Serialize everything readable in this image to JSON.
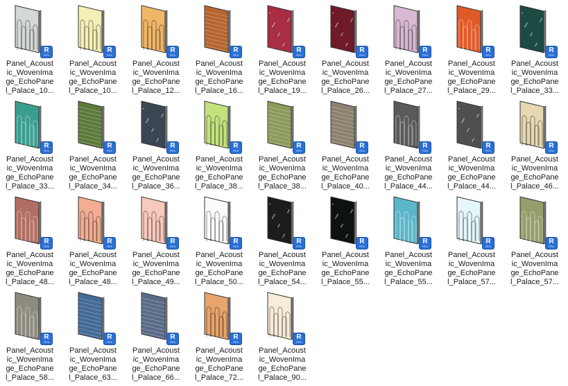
{
  "window": {
    "background": "#ffffff"
  },
  "badge": {
    "letter": "R",
    "sub": "RFA",
    "color": "#2a6fd6"
  },
  "files": [
    {
      "lines": [
        "Panel_Acoust",
        "ic_WovenIma",
        "ge_EchoPane",
        "l_Palace_10..."
      ],
      "color": "#d4d8d6",
      "pattern": "arch",
      "dark": false
    },
    {
      "lines": [
        "Panel_Acoust",
        "ic_WovenIma",
        "ge_EchoPane",
        "l_Palace_10..."
      ],
      "color": "#f3efb6",
      "pattern": "arch",
      "dark": false
    },
    {
      "lines": [
        "Panel_Acoust",
        "ic_WovenIma",
        "ge_EchoPane",
        "l_Palace_12..."
      ],
      "color": "#f0b668",
      "pattern": "arch",
      "dark": false
    },
    {
      "lines": [
        "Panel_Acoust",
        "ic_WovenIma",
        "ge_EchoPane",
        "l_Palace_16..."
      ],
      "color": "#b56530",
      "pattern": "lines",
      "dark": true
    },
    {
      "lines": [
        "Panel_Acoust",
        "ic_WovenIma",
        "ge_EchoPane",
        "l_Palace_19..."
      ],
      "color": "#a82d45",
      "pattern": "dots",
      "dark": true
    },
    {
      "lines": [
        "Panel_Acoust",
        "ic_WovenIma",
        "ge_EchoPane",
        "l_Palace_26..."
      ],
      "color": "#6e1a29",
      "pattern": "dots",
      "dark": true
    },
    {
      "lines": [
        "Panel_Acoust",
        "ic_WovenIma",
        "ge_EchoPane",
        "l_Palace_27..."
      ],
      "color": "#d9b8d3",
      "pattern": "arch",
      "dark": false
    },
    {
      "lines": [
        "Panel_Acoust",
        "ic_WovenIma",
        "ge_EchoPane",
        "l_Palace_29..."
      ],
      "color": "#e05a28",
      "pattern": "arch",
      "dark": true
    },
    {
      "lines": [
        "Panel_Acoust",
        "ic_WovenIma",
        "ge_EchoPane",
        "l_Palace_33..."
      ],
      "color": "#1e4a44",
      "pattern": "dots",
      "dark": true
    },
    {
      "lines": [
        "Panel_Acoust",
        "ic_WovenIma",
        "ge_EchoPane",
        "l_Palace_33..."
      ],
      "color": "#3a9e8e",
      "pattern": "arch",
      "dark": true
    },
    {
      "lines": [
        "Panel_Acoust",
        "ic_WovenIma",
        "ge_EchoPane",
        "l_Palace_34..."
      ],
      "color": "#5d7a3c",
      "pattern": "lines",
      "dark": true
    },
    {
      "lines": [
        "Panel_Acoust",
        "ic_WovenIma",
        "ge_EchoPane",
        "l_Palace_36..."
      ],
      "color": "#3c4552",
      "pattern": "dots",
      "dark": true
    },
    {
      "lines": [
        "Panel_Acoust",
        "ic_WovenIma",
        "ge_EchoPane",
        "l_Palace_38..."
      ],
      "color": "#c3e27e",
      "pattern": "arch",
      "dark": false
    },
    {
      "lines": [
        "Panel_Acoust",
        "ic_WovenIma",
        "ge_EchoPane",
        "l_Palace_38..."
      ],
      "color": "#8c9a5a",
      "pattern": "lines",
      "dark": true
    },
    {
      "lines": [
        "Panel_Acoust",
        "ic_WovenIma",
        "ge_EchoPane",
        "l_Palace_40..."
      ],
      "color": "#8c806e",
      "pattern": "lines",
      "dark": true
    },
    {
      "lines": [
        "Panel_Acoust",
        "ic_WovenIma",
        "ge_EchoPane",
        "l_Palace_44..."
      ],
      "color": "#5a5a5a",
      "pattern": "arch",
      "dark": true
    },
    {
      "lines": [
        "Panel_Acoust",
        "ic_WovenIma",
        "ge_EchoPane",
        "l_Palace_44..."
      ],
      "color": "#4f4f4f",
      "pattern": "dots",
      "dark": true
    },
    {
      "lines": [
        "Panel_Acoust",
        "ic_WovenIma",
        "ge_EchoPane",
        "l_Palace_46..."
      ],
      "color": "#e6d8b2",
      "pattern": "arch",
      "dark": false
    },
    {
      "lines": [
        "Panel_Acoust",
        "ic_WovenIma",
        "ge_EchoPane",
        "l_Palace_48..."
      ],
      "color": "#b16e62",
      "pattern": "arch",
      "dark": true
    },
    {
      "lines": [
        "Panel_Acoust",
        "ic_WovenIma",
        "ge_EchoPane",
        "l_Palace_48..."
      ],
      "color": "#f3ad92",
      "pattern": "arch",
      "dark": false
    },
    {
      "lines": [
        "Panel_Acoust",
        "ic_WovenIma",
        "ge_EchoPane",
        "l_Palace_49..."
      ],
      "color": "#f8c9bd",
      "pattern": "arch",
      "dark": false
    },
    {
      "lines": [
        "Panel_Acoust",
        "ic_WovenIma",
        "ge_EchoPane",
        "l_Palace_50..."
      ],
      "color": "#fbfbfb",
      "pattern": "arch",
      "dark": false
    },
    {
      "lines": [
        "Panel_Acoust",
        "ic_WovenIma",
        "ge_EchoPane",
        "l_Palace_54..."
      ],
      "color": "#1c1c1c",
      "pattern": "dots",
      "dark": true
    },
    {
      "lines": [
        "Panel_Acoust",
        "ic_WovenIma",
        "ge_EchoPane",
        "l_Palace_55..."
      ],
      "color": "#0d1310",
      "pattern": "dots",
      "dark": true
    },
    {
      "lines": [
        "Panel_Acoust",
        "ic_WovenIma",
        "ge_EchoPane",
        "l_Palace_55..."
      ],
      "color": "#5ab7c9",
      "pattern": "arch",
      "dark": true
    },
    {
      "lines": [
        "Panel_Acoust",
        "ic_WovenIma",
        "ge_EchoPane",
        "l_Palace_57..."
      ],
      "color": "#e4f6f8",
      "pattern": "arch",
      "dark": false
    },
    {
      "lines": [
        "Panel_Acoust",
        "ic_WovenIma",
        "ge_EchoPane",
        "l_Palace_57..."
      ],
      "color": "#959e6a",
      "pattern": "arch",
      "dark": true
    },
    {
      "lines": [
        "Panel_Acoust",
        "ic_WovenIma",
        "ge_EchoPane",
        "l_Palace_58..."
      ],
      "color": "#8d8b7e",
      "pattern": "arch",
      "dark": true
    },
    {
      "lines": [
        "Panel_Acoust",
        "ic_WovenIma",
        "ge_EchoPane",
        "l_Palace_63..."
      ],
      "color": "#446a96",
      "pattern": "lines",
      "dark": true
    },
    {
      "lines": [
        "Panel_Acoust",
        "ic_WovenIma",
        "ge_EchoPane",
        "l_Palace_66..."
      ],
      "color": "#5a6b88",
      "pattern": "lines",
      "dark": true
    },
    {
      "lines": [
        "Panel_Acoust",
        "ic_WovenIma",
        "ge_EchoPane",
        "l_Palace_72..."
      ],
      "color": "#e8a46c",
      "pattern": "arch",
      "dark": false
    },
    {
      "lines": [
        "Panel_Acoust",
        "ic_WovenIma",
        "ge_EchoPane",
        "l_Palace_90..."
      ],
      "color": "#f6ecd8",
      "pattern": "arch",
      "dark": false
    }
  ]
}
